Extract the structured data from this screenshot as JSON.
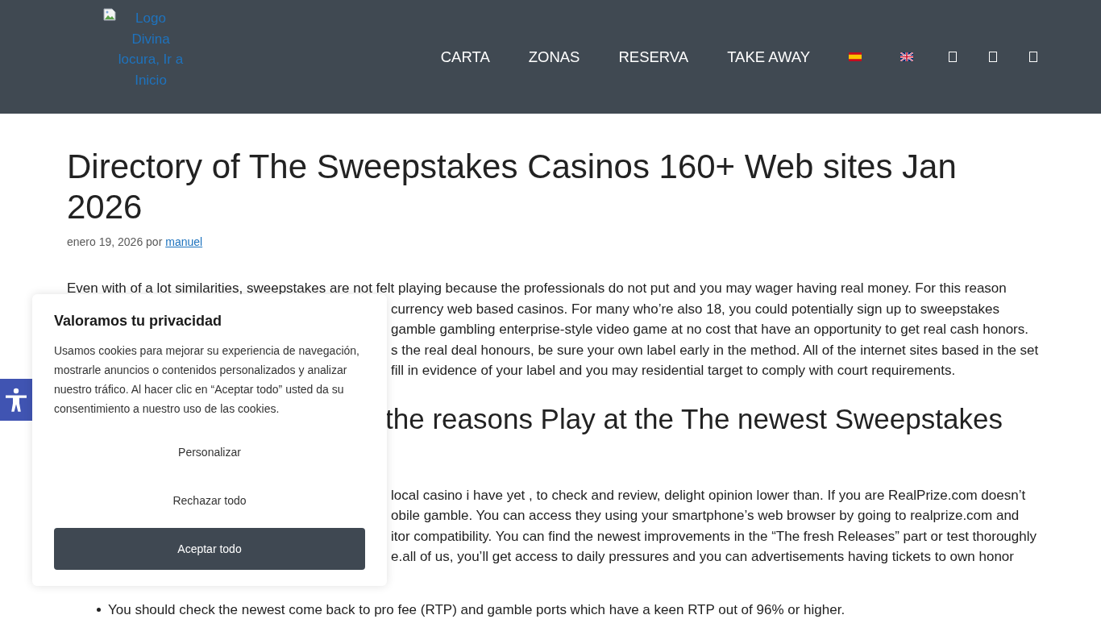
{
  "header": {
    "logo_alt_text": "Logo Divina locura, Ir a Inicio",
    "nav": [
      {
        "label": "CARTA"
      },
      {
        "label": "ZONAS"
      },
      {
        "label": "RESERVA"
      },
      {
        "label": "TAKE AWAY"
      }
    ]
  },
  "article": {
    "title": "Directory of The Sweepstakes Casinos 160+ Web sites Jan 2026",
    "byline": {
      "date_text": "enero 19, 2026 por",
      "author": "manuel"
    },
    "paragraph_1": {
      "first_line": "Even with of a lot similarities, sweepstakes are not felt playing because the professionals do not put and you may wager having real money. For this reason",
      "visible_line_ends": [
        "currency web based casinos. For many who’re also 18, you could potentially sign up to sweepstakes",
        "gamble gambling enterprise-style video game at no cost that have an opportunity to get real cash honors.",
        "s the real deal honours, be sure your own label early in the method. All of the internet sites based in the set",
        "fill in evidence of your label and you may residential target to comply with court requirements."
      ]
    },
    "heading_2_visible_part": "the reasons Play at the The newest Sweepstakes",
    "paragraph_2_visible_line_ends": [
      "local casino i have yet , to check and review, delight opinion lower than. If you are RealPrize.com doesn’t",
      "obile gamble. You can access they using your smartphone’s web browser by going to realprize.com and",
      "itor compatibility. You can find the newest improvements in the “The fresh Releases” part or test thoroughly",
      "e.all of us, you’ll get access to daily pressures and you can advertisements having tickets to own honor"
    ],
    "list_items": [
      "You should check the newest come back to pro fee (RTP) and gamble ports which have a keen RTP out of 96% or higher."
    ]
  },
  "cookie_dialog": {
    "title": "Valoramos tu privacidad",
    "body": "Usamos cookies para mejorar su experiencia de navegación, mostrarle anuncios o contenidos personalizados y analizar nuestro tráfico. Al hacer clic en “Aceptar todo” usted da su consentimiento a nuestro uso de las cookies.",
    "buttons": [
      {
        "label": "Personalizar",
        "kind": "plain"
      },
      {
        "label": "Rechazar todo",
        "kind": "plain"
      },
      {
        "label": "Aceptar todo",
        "kind": "primary"
      }
    ]
  }
}
